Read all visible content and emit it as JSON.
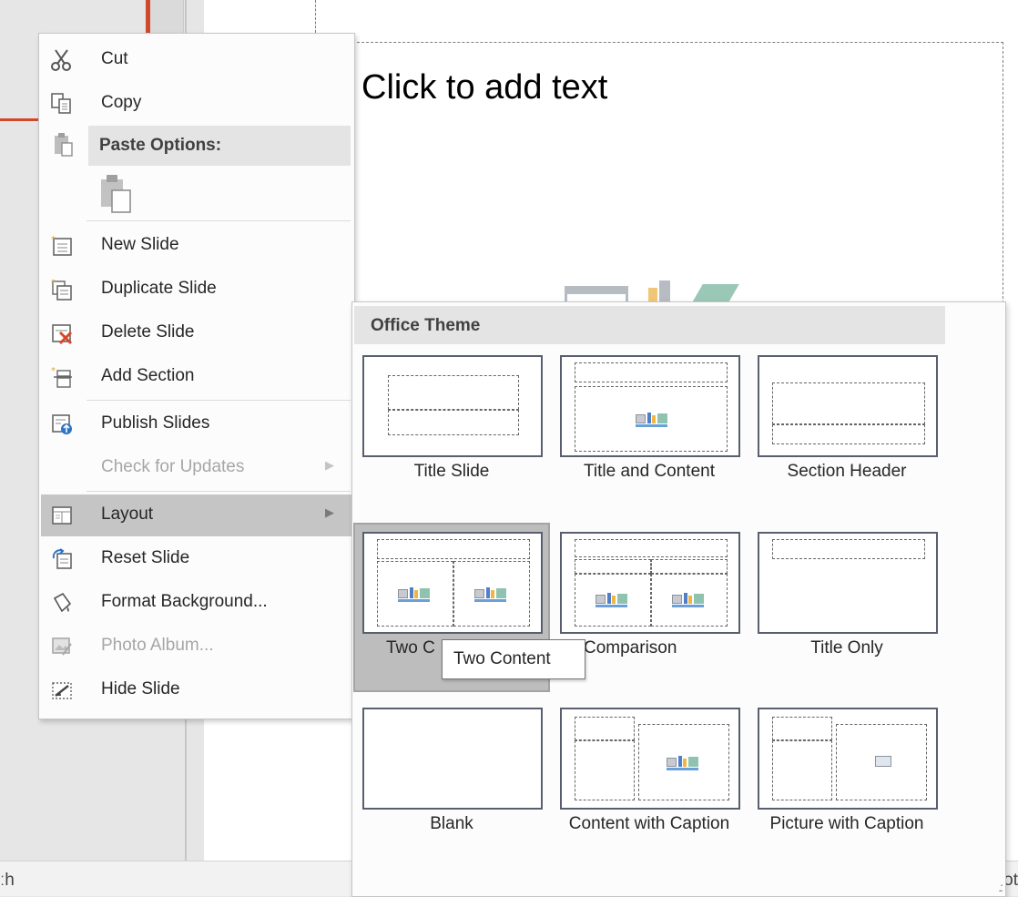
{
  "slide": {
    "placeholder_text": "Click to add text"
  },
  "status_bar": {
    "left_text": "ːh",
    "right_text": ".: Not"
  },
  "context_menu": {
    "items": [
      {
        "label": "Cut",
        "icon": "scissors-icon",
        "disabled": false
      },
      {
        "label": "Copy",
        "icon": "copy-icon",
        "disabled": false
      },
      {
        "label": "Paste Options:",
        "icon": "paste-icon",
        "header": true
      },
      {
        "label": "New Slide",
        "icon": "new-slide-icon",
        "disabled": false
      },
      {
        "label": "Duplicate Slide",
        "icon": "duplicate-slide-icon",
        "disabled": false
      },
      {
        "label": "Delete Slide",
        "icon": "delete-slide-icon",
        "disabled": false
      },
      {
        "label": "Add Section",
        "icon": "add-section-icon",
        "disabled": false
      },
      {
        "label": "Publish Slides",
        "icon": "publish-slides-icon",
        "disabled": false
      },
      {
        "label": "Check for Updates",
        "icon": "",
        "disabled": true,
        "submenu": true
      },
      {
        "label": "Layout",
        "icon": "layout-icon",
        "disabled": false,
        "submenu": true,
        "highlighted": true
      },
      {
        "label": "Reset Slide",
        "icon": "reset-slide-icon",
        "disabled": false
      },
      {
        "label": "Format Background...",
        "icon": "format-background-icon",
        "disabled": false
      },
      {
        "label": "Photo Album...",
        "icon": "photo-album-icon",
        "disabled": true
      },
      {
        "label": "Hide Slide",
        "icon": "hide-slide-icon",
        "disabled": false
      }
    ]
  },
  "layout_gallery": {
    "header": "Office Theme",
    "layouts": [
      {
        "label": "Title Slide"
      },
      {
        "label": "Title and Content"
      },
      {
        "label": "Section Header"
      },
      {
        "label": "Two Content",
        "selected": true
      },
      {
        "label": "Comparison"
      },
      {
        "label": "Title Only"
      },
      {
        "label": "Blank"
      },
      {
        "label": "Content with Caption"
      },
      {
        "label": "Picture with Caption"
      }
    ],
    "visible_partial_label": "Two C"
  },
  "tooltip": {
    "text": "Two Content"
  },
  "colors": {
    "accent_red": "#d0492a",
    "menu_highlight": "#c5c5c5",
    "header_bg": "#e4e4e4",
    "disabled_text": "#a6a6a6"
  }
}
